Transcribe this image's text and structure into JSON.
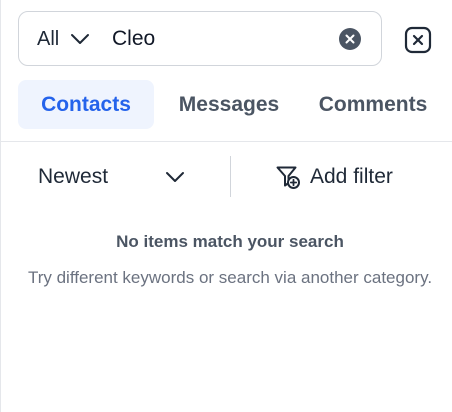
{
  "search": {
    "scope": "All",
    "query": "Cleo",
    "placeholder": ""
  },
  "tabs": [
    {
      "label": "Contacts",
      "active": true
    },
    {
      "label": "Messages",
      "active": false
    },
    {
      "label": "Comments",
      "active": false
    }
  ],
  "toolbar": {
    "sort_label": "Newest",
    "add_filter_label": "Add filter"
  },
  "empty_state": {
    "title": "No items match your search",
    "description": "Try different keywords or search via another category."
  },
  "icons": {
    "scope_chevron": "chevron-down-icon",
    "clear": "clear-circle-icon",
    "close": "close-square-icon",
    "sort_chevron": "chevron-down-icon",
    "filter": "filter-add-icon"
  },
  "colors": {
    "accent": "#2563eb",
    "active_tab_bg": "#eff4fe",
    "text_primary": "#1f2937",
    "text_muted": "#6b7280",
    "border": "#d1d5db"
  }
}
